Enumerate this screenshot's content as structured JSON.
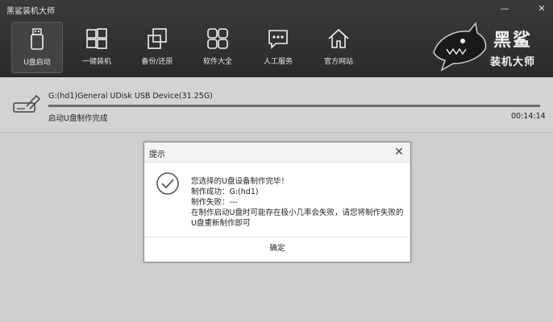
{
  "app": {
    "title": "黑鲨装机大师"
  },
  "window_controls": {
    "minimize": "—",
    "close": "✕"
  },
  "nav": {
    "items": [
      {
        "label": "U盘启动",
        "icon": "usb-icon",
        "active": true
      },
      {
        "label": "一键装机",
        "icon": "windows-icon",
        "active": false
      },
      {
        "label": "备份/还原",
        "icon": "backup-icon",
        "active": false
      },
      {
        "label": "软件大全",
        "icon": "apps-grid-icon",
        "active": false
      },
      {
        "label": "人工服务",
        "icon": "chat-icon",
        "active": false
      },
      {
        "label": "官方网站",
        "icon": "home-icon",
        "active": false
      }
    ]
  },
  "logo": {
    "line1": "黑鲨",
    "line2": "装机大师"
  },
  "device": {
    "name": "G:(hd1)General UDisk USB Device(31.25G)",
    "status": "启动U盘制作完成",
    "elapsed": "00:14:14",
    "progress_percent": 100
  },
  "dialog": {
    "title": "提示",
    "close": "✕",
    "lines": [
      "您选择的U盘设备制作完毕！",
      "制作成功：G:(hd1)",
      "制作失败：---",
      "在制作启动U盘时可能存在极小几率会失败，请您将制作失败的",
      "U盘重新制作即可"
    ],
    "ok": "确定"
  },
  "colors": {
    "topbar": "#2f2f2f",
    "panel": "#d3d3d3",
    "background": "#cfcfcf",
    "progress": "#6a6a6a"
  }
}
